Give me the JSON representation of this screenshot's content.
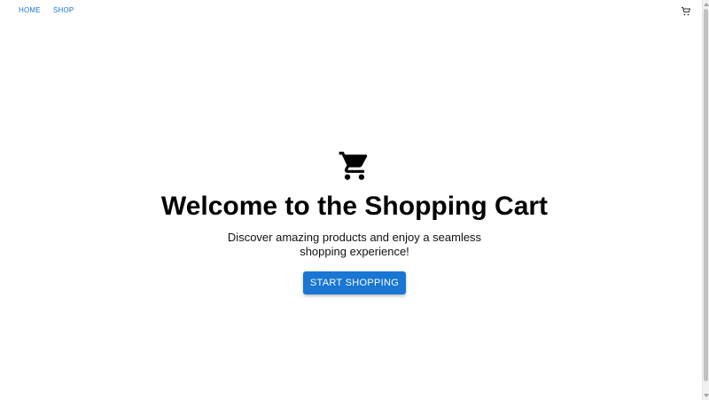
{
  "nav": {
    "home_label": "HOME",
    "shop_label": "SHOP",
    "cart_icon": "cart-icon"
  },
  "hero": {
    "icon": "shopping-cart-icon",
    "title": "Welcome to the Shopping Cart",
    "subtitle": "Discover amazing products and enjoy a seamless shopping experience!",
    "button_label": "START SHOPPING"
  },
  "colors": {
    "accent": "#1976d2",
    "text": "#000000",
    "background": "#ffffff"
  }
}
